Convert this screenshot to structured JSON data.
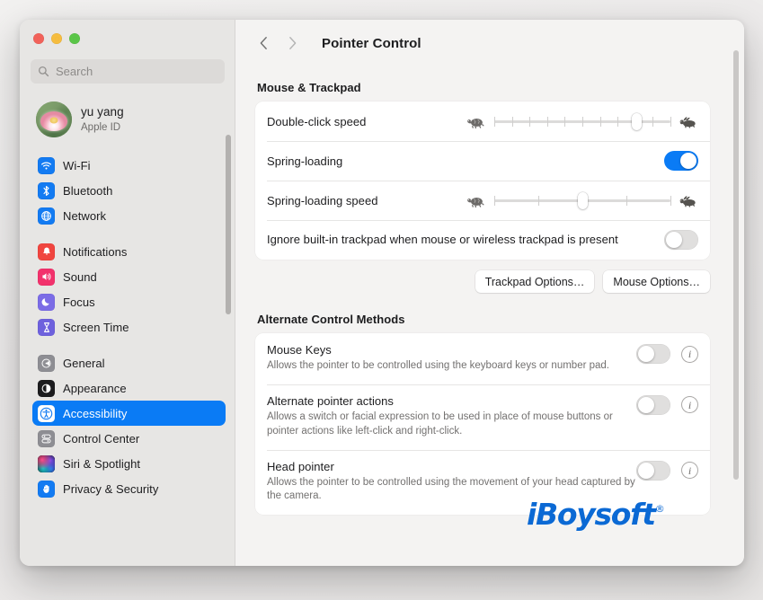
{
  "window": {
    "title": "Pointer Control",
    "traffic_lights": [
      "close",
      "minimize",
      "zoom"
    ]
  },
  "sidebar": {
    "search": {
      "placeholder": "Search",
      "value": ""
    },
    "account": {
      "name": "yu yang",
      "subtitle": "Apple ID"
    },
    "groups": [
      {
        "items": [
          {
            "label": "Wi-Fi",
            "icon": "wifi-icon",
            "color": "#137bf2",
            "selected": false
          },
          {
            "label": "Bluetooth",
            "icon": "bluetooth-icon",
            "color": "#137bf2",
            "selected": false
          },
          {
            "label": "Network",
            "icon": "globe-icon",
            "color": "#137bf2",
            "selected": false
          }
        ]
      },
      {
        "items": [
          {
            "label": "Notifications",
            "icon": "bell-icon",
            "color": "#f0453f",
            "selected": false
          },
          {
            "label": "Sound",
            "icon": "speaker-icon",
            "color": "#f2326c",
            "selected": false
          },
          {
            "label": "Focus",
            "icon": "moon-icon",
            "color": "#7b6ce6",
            "selected": false
          },
          {
            "label": "Screen Time",
            "icon": "hourglass-icon",
            "color": "#6e61dd",
            "selected": false
          }
        ]
      },
      {
        "items": [
          {
            "label": "General",
            "icon": "gear-icon",
            "color": "#8e8e93",
            "selected": false
          },
          {
            "label": "Appearance",
            "icon": "appearance-icon",
            "color": "#1c1c1e",
            "selected": false
          },
          {
            "label": "Accessibility",
            "icon": "accessibility-icon",
            "color": "#137bf2",
            "selected": true
          },
          {
            "label": "Control Center",
            "icon": "control-center-icon",
            "color": "#8e8e93",
            "selected": false
          },
          {
            "label": "Siri & Spotlight",
            "icon": "siri-icon",
            "color": "#1c1c1e",
            "selected": false
          },
          {
            "label": "Privacy & Security",
            "icon": "hand-icon",
            "color": "#137bf2",
            "selected": false
          }
        ]
      }
    ]
  },
  "main": {
    "nav": {
      "back": "back-chevron",
      "forward": "forward-chevron"
    },
    "sections": [
      {
        "heading": "Mouse & Trackpad",
        "rows": [
          {
            "label": "Double-click speed",
            "control": "slider",
            "ticks": 11,
            "value_percent": 81,
            "left_icon": "turtle-icon",
            "right_icon": "hare-icon"
          },
          {
            "label": "Spring-loading",
            "control": "toggle",
            "state": "on"
          },
          {
            "label": "Spring-loading speed",
            "control": "slider",
            "ticks": 5,
            "value_percent": 50,
            "left_icon": "turtle-icon",
            "right_icon": "hare-icon"
          },
          {
            "label": "Ignore built-in trackpad when mouse or wireless trackpad is present",
            "control": "toggle",
            "state": "off"
          }
        ],
        "buttons": [
          {
            "label": "Trackpad Options…"
          },
          {
            "label": "Mouse Options…"
          }
        ]
      },
      {
        "heading": "Alternate Control Methods",
        "features": [
          {
            "title": "Mouse Keys",
            "description": "Allows the pointer to be controlled using the keyboard keys or number pad.",
            "state": "off",
            "info": "ⓘ"
          },
          {
            "title": "Alternate pointer actions",
            "description": "Allows a switch or facial expression to be used in place of mouse buttons or pointer actions like left-click and right-click.",
            "state": "off",
            "info": "ⓘ"
          },
          {
            "title": "Head pointer",
            "description": "Allows the pointer to be controlled using the movement of your head captured by the camera.",
            "state": "off",
            "info": "ⓘ"
          }
        ]
      }
    ]
  },
  "watermark": {
    "text": "iBoysoft",
    "mark": "®",
    "color": "#0b69d4"
  },
  "colors": {
    "accent": "#0a7bf5",
    "sidebar_bg": "#e7e6e4",
    "main_bg": "#f4f3f2",
    "card_bg": "#ffffff"
  }
}
